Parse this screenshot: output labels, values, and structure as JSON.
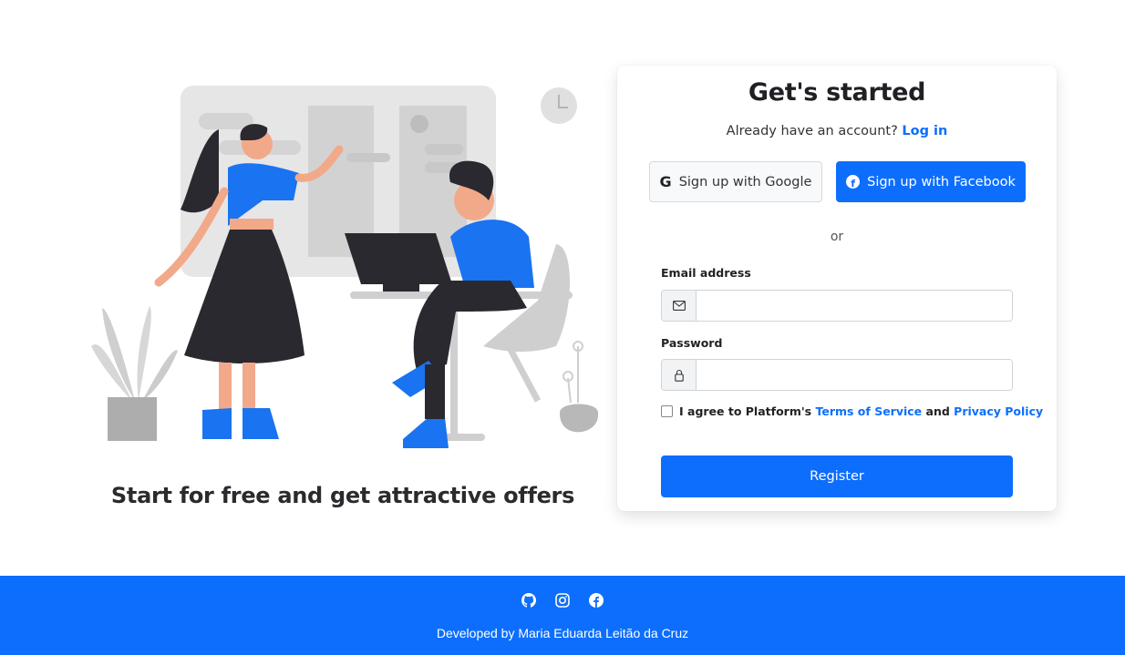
{
  "illustration": {
    "icon": "people-working-illustration"
  },
  "tagline": "Start for free and get attractive offers",
  "card": {
    "title": "Get's started",
    "login_prompt": "Already have an account?",
    "login_link": "Log in",
    "google_button": "Sign up with Google",
    "facebook_button": "Sign up with Facebook",
    "or_text": "or",
    "email_label": "Email address",
    "email_value": "",
    "email_icon": "envelope-icon",
    "password_label": "Password",
    "password_value": "",
    "password_icon": "lock-icon",
    "agree_prefix": "I agree to Platform's",
    "terms_link": "Terms of Service",
    "agree_and": "and",
    "privacy_link": "Privacy Policy",
    "register_button": "Register"
  },
  "footer": {
    "icons": [
      "github-icon",
      "instagram-icon",
      "facebook-icon"
    ],
    "credit": "Developed by Maria Eduarda Leitão da Cruz"
  },
  "colors": {
    "accent": "#0d6efd",
    "footer_bg": "#0d6efd",
    "dark_text": "#1f2024"
  }
}
